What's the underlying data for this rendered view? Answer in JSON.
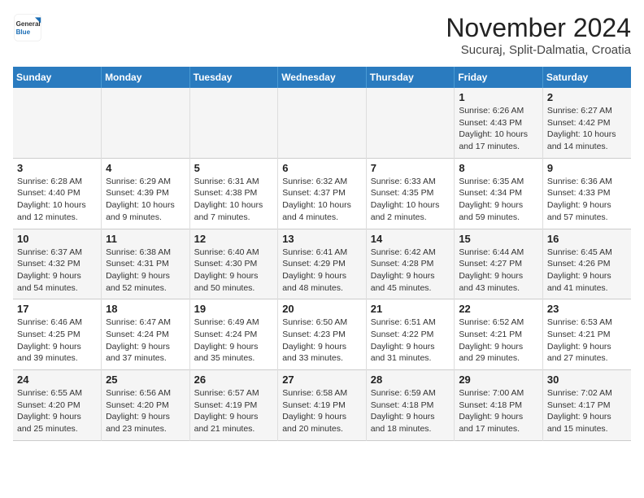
{
  "logo": {
    "general": "General",
    "blue": "Blue"
  },
  "title": "November 2024",
  "location": "Sucuraj, Split-Dalmatia, Croatia",
  "days_of_week": [
    "Sunday",
    "Monday",
    "Tuesday",
    "Wednesday",
    "Thursday",
    "Friday",
    "Saturday"
  ],
  "weeks": [
    [
      {
        "day": "",
        "info": ""
      },
      {
        "day": "",
        "info": ""
      },
      {
        "day": "",
        "info": ""
      },
      {
        "day": "",
        "info": ""
      },
      {
        "day": "",
        "info": ""
      },
      {
        "day": "1",
        "info": "Sunrise: 6:26 AM\nSunset: 4:43 PM\nDaylight: 10 hours and 17 minutes."
      },
      {
        "day": "2",
        "info": "Sunrise: 6:27 AM\nSunset: 4:42 PM\nDaylight: 10 hours and 14 minutes."
      }
    ],
    [
      {
        "day": "3",
        "info": "Sunrise: 6:28 AM\nSunset: 4:40 PM\nDaylight: 10 hours and 12 minutes."
      },
      {
        "day": "4",
        "info": "Sunrise: 6:29 AM\nSunset: 4:39 PM\nDaylight: 10 hours and 9 minutes."
      },
      {
        "day": "5",
        "info": "Sunrise: 6:31 AM\nSunset: 4:38 PM\nDaylight: 10 hours and 7 minutes."
      },
      {
        "day": "6",
        "info": "Sunrise: 6:32 AM\nSunset: 4:37 PM\nDaylight: 10 hours and 4 minutes."
      },
      {
        "day": "7",
        "info": "Sunrise: 6:33 AM\nSunset: 4:35 PM\nDaylight: 10 hours and 2 minutes."
      },
      {
        "day": "8",
        "info": "Sunrise: 6:35 AM\nSunset: 4:34 PM\nDaylight: 9 hours and 59 minutes."
      },
      {
        "day": "9",
        "info": "Sunrise: 6:36 AM\nSunset: 4:33 PM\nDaylight: 9 hours and 57 minutes."
      }
    ],
    [
      {
        "day": "10",
        "info": "Sunrise: 6:37 AM\nSunset: 4:32 PM\nDaylight: 9 hours and 54 minutes."
      },
      {
        "day": "11",
        "info": "Sunrise: 6:38 AM\nSunset: 4:31 PM\nDaylight: 9 hours and 52 minutes."
      },
      {
        "day": "12",
        "info": "Sunrise: 6:40 AM\nSunset: 4:30 PM\nDaylight: 9 hours and 50 minutes."
      },
      {
        "day": "13",
        "info": "Sunrise: 6:41 AM\nSunset: 4:29 PM\nDaylight: 9 hours and 48 minutes."
      },
      {
        "day": "14",
        "info": "Sunrise: 6:42 AM\nSunset: 4:28 PM\nDaylight: 9 hours and 45 minutes."
      },
      {
        "day": "15",
        "info": "Sunrise: 6:44 AM\nSunset: 4:27 PM\nDaylight: 9 hours and 43 minutes."
      },
      {
        "day": "16",
        "info": "Sunrise: 6:45 AM\nSunset: 4:26 PM\nDaylight: 9 hours and 41 minutes."
      }
    ],
    [
      {
        "day": "17",
        "info": "Sunrise: 6:46 AM\nSunset: 4:25 PM\nDaylight: 9 hours and 39 minutes."
      },
      {
        "day": "18",
        "info": "Sunrise: 6:47 AM\nSunset: 4:24 PM\nDaylight: 9 hours and 37 minutes."
      },
      {
        "day": "19",
        "info": "Sunrise: 6:49 AM\nSunset: 4:24 PM\nDaylight: 9 hours and 35 minutes."
      },
      {
        "day": "20",
        "info": "Sunrise: 6:50 AM\nSunset: 4:23 PM\nDaylight: 9 hours and 33 minutes."
      },
      {
        "day": "21",
        "info": "Sunrise: 6:51 AM\nSunset: 4:22 PM\nDaylight: 9 hours and 31 minutes."
      },
      {
        "day": "22",
        "info": "Sunrise: 6:52 AM\nSunset: 4:21 PM\nDaylight: 9 hours and 29 minutes."
      },
      {
        "day": "23",
        "info": "Sunrise: 6:53 AM\nSunset: 4:21 PM\nDaylight: 9 hours and 27 minutes."
      }
    ],
    [
      {
        "day": "24",
        "info": "Sunrise: 6:55 AM\nSunset: 4:20 PM\nDaylight: 9 hours and 25 minutes."
      },
      {
        "day": "25",
        "info": "Sunrise: 6:56 AM\nSunset: 4:20 PM\nDaylight: 9 hours and 23 minutes."
      },
      {
        "day": "26",
        "info": "Sunrise: 6:57 AM\nSunset: 4:19 PM\nDaylight: 9 hours and 21 minutes."
      },
      {
        "day": "27",
        "info": "Sunrise: 6:58 AM\nSunset: 4:19 PM\nDaylight: 9 hours and 20 minutes."
      },
      {
        "day": "28",
        "info": "Sunrise: 6:59 AM\nSunset: 4:18 PM\nDaylight: 9 hours and 18 minutes."
      },
      {
        "day": "29",
        "info": "Sunrise: 7:00 AM\nSunset: 4:18 PM\nDaylight: 9 hours and 17 minutes."
      },
      {
        "day": "30",
        "info": "Sunrise: 7:02 AM\nSunset: 4:17 PM\nDaylight: 9 hours and 15 minutes."
      }
    ]
  ]
}
